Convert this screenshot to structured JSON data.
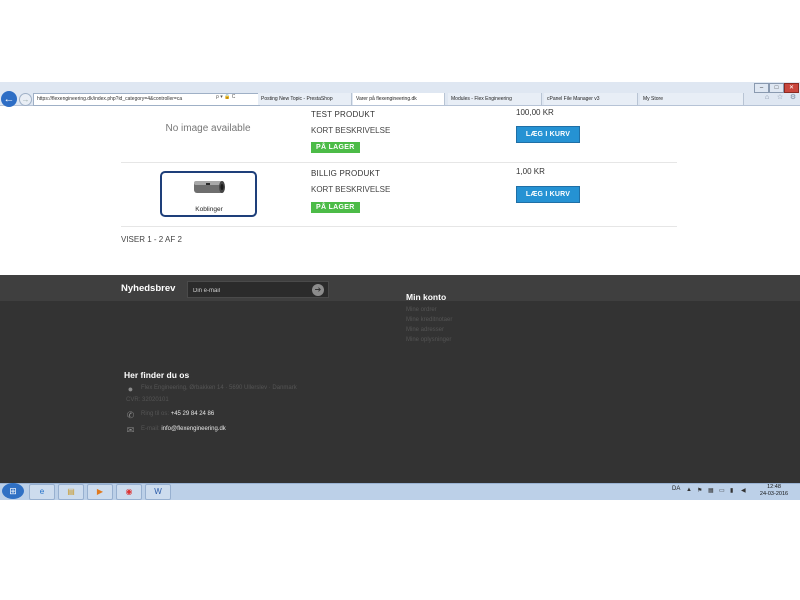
{
  "browser": {
    "address_url": "https://flexengineering.dk/index.php?id_category=4&controller=ca",
    "address_icons": "ρ ▾ 🔒 C",
    "tabs": [
      {
        "label": "Posting New Topic - PrestaShop"
      },
      {
        "label": "Varer på flexengineering.dk"
      },
      {
        "label": "Modules - Flex Engineering"
      },
      {
        "label": "cPanel File Manager v3"
      },
      {
        "label": "My Store"
      }
    ],
    "window_controls": {
      "minimize": "–",
      "maximize": "□",
      "close": "✕"
    }
  },
  "products": [
    {
      "image_label": "No image available",
      "name": "TEST PRODUKT",
      "description": "KORT BESKRIVELSE",
      "stock_badge": "PÅ LAGER",
      "price": "100,00 KR",
      "cart_button": "LÆG I KURV"
    },
    {
      "image_label": "Koblinger",
      "name": "BILLIG PRODUKT",
      "description": "KORT BESKRIVELSE",
      "stock_badge": "PÅ LAGER",
      "price": "1,00 KR",
      "cart_button": "LÆG I KURV"
    }
  ],
  "pagination": {
    "showing": "VISER 1 - 2 AF 2"
  },
  "footer": {
    "newsletter": {
      "title": "Nyhedsbrev",
      "placeholder": "Din e-mail"
    },
    "account": {
      "title": "Min konto",
      "links": [
        "Mine ordrer",
        "Mine kreditnotaer",
        "Mine adresser",
        "Mine oplysninger"
      ]
    },
    "location": {
      "title": "Her finder du os",
      "address": "Flex Engineering, Ørbakken 14 · 5690 Ullerslev · Danmark",
      "cvr": "CVR: 32020101",
      "phone_label": "Ring til os:",
      "phone": "+45 29 84 24 86",
      "email_label": "E-mail:",
      "email": "info@flexengineering.dk"
    }
  },
  "taskbar": {
    "lang": "DA",
    "time": "12:48",
    "date": "24-03-2016"
  }
}
